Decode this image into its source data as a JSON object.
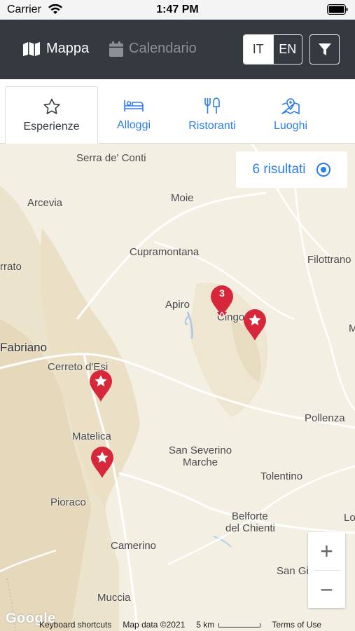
{
  "status_bar": {
    "carrier": "Carrier",
    "time": "1:47 PM"
  },
  "header": {
    "map_tab": "Mappa",
    "calendar_tab": "Calendario",
    "lang_it": "IT",
    "lang_en": "EN"
  },
  "categories": [
    {
      "label": "Esperienze",
      "icon": "star-outline-icon",
      "active": true
    },
    {
      "label": "Alloggi",
      "icon": "bed-icon",
      "active": false
    },
    {
      "label": "Ristoranti",
      "icon": "utensils-icon",
      "active": false
    },
    {
      "label": "Luoghi",
      "icon": "map-pin-icon",
      "active": false
    }
  ],
  "map": {
    "results_label": "6 risultati",
    "cluster_count": "3",
    "places": {
      "serra": "Serra de' Conti",
      "arcevia": "Arcevia",
      "moie": "Moie",
      "cupramontana": "Cupramontana",
      "filottrano": "Filottrano",
      "rrato": "rrato",
      "apiro": "Apiro",
      "cingoli": "Cingo",
      "fabriano": "Fabriano",
      "cerreto": "Cerreto d'Esi",
      "pollenza": "Pollenza",
      "matelica": "Matelica",
      "san_severino": "San Severino",
      "marche": "Marche",
      "tolentino": "Tolentino",
      "pioraco": "Pioraco",
      "belforte": "Belforte",
      "del_chienti": "del Chienti",
      "camerino": "Camerino",
      "san_gi": "San Gi",
      "muccia": "Muccia",
      "m_edge": "M",
      "lo_edge": "Lo"
    },
    "zoom_in": "+",
    "zoom_out": "−",
    "google": "Google",
    "footer": {
      "shortcuts": "Keyboard shortcuts",
      "map_data": "Map data ©2021",
      "scale": "5 km",
      "terms": "Terms of Use"
    }
  },
  "colors": {
    "header": "#343a40",
    "accent": "#2b7de9",
    "marker": "#d6283a"
  }
}
